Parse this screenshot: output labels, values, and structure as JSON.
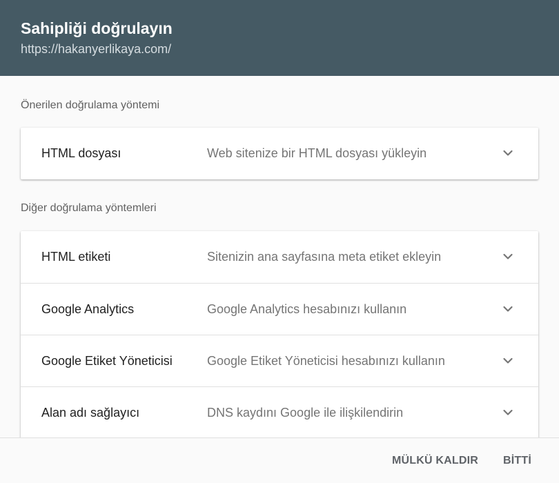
{
  "header": {
    "title": "Sahipliği doğrulayın",
    "url": "https://hakanyerlikaya.com/"
  },
  "recommended": {
    "label": "Önerilen doğrulama yöntemi",
    "items": [
      {
        "title": "HTML dosyası",
        "description": "Web sitenize bir HTML dosyası yükleyin",
        "icon": "chevron-down-icon"
      }
    ]
  },
  "other": {
    "label": "Diğer doğrulama yöntemleri",
    "items": [
      {
        "title": "HTML etiketi",
        "description": "Sitenizin ana sayfasına meta etiket ekleyin",
        "icon": "chevron-down-icon"
      },
      {
        "title": "Google Analytics",
        "description": "Google Analytics hesabınızı kullanın",
        "icon": "chevron-down-icon"
      },
      {
        "title": "Google Etiket Yöneticisi",
        "description": "Google Etiket Yöneticisi hesabınızı kullanın",
        "icon": "chevron-down-icon"
      },
      {
        "title": "Alan adı sağlayıcı",
        "description": "DNS kaydını Google ile ilişkilendirin",
        "icon": "chevron-down-icon"
      }
    ]
  },
  "footer": {
    "remove_label": "MÜLKÜ KALDIR",
    "done_label": "BİTTİ"
  },
  "colors": {
    "header_bg": "#455a64",
    "text_primary": "#212121",
    "text_secondary": "#757575",
    "button_text": "#5f6368"
  }
}
